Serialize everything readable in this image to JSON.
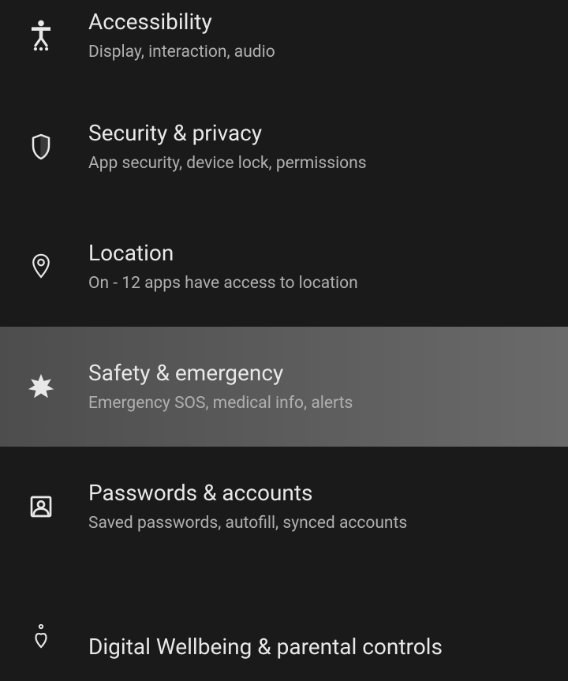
{
  "settings": {
    "items": [
      {
        "title": "Accessibility",
        "subtitle": "Display, interaction, audio"
      },
      {
        "title": "Security & privacy",
        "subtitle": "App security, device lock, permissions"
      },
      {
        "title": "Location",
        "subtitle": "On - 12 apps have access to location"
      },
      {
        "title": "Safety & emergency",
        "subtitle": "Emergency SOS, medical info, alerts"
      },
      {
        "title": "Passwords & accounts",
        "subtitle": "Saved passwords, autofill, synced accounts"
      },
      {
        "title": "Digital Wellbeing & parental controls",
        "subtitle": ""
      }
    ]
  }
}
